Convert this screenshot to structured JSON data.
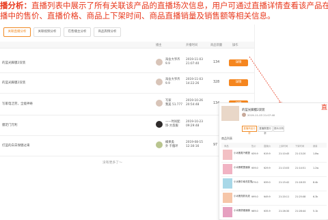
{
  "header": {
    "line1_prefix": "播分析：",
    "line1_body": "直播列表中展示了所有关联该产品的直播场次信息，用户可通过直播详情查看该产品在",
    "line2": "播中的售价、直播价格、商品上下架时间、商品直播销量及销售额等相关信息。"
  },
  "tabs": [
    "关联直播分析",
    "关联视频分析",
    "在售播主分析",
    "商品舆情分析"
  ],
  "table_headers": [
    "播主",
    "开播时间",
    "商品销量",
    "操作"
  ],
  "rows": [
    {
      "title": "的蓝光脚膜2双装",
      "anchor": "海舍大爷齐",
      "anchor_sub": "9.9",
      "date": "2019-11-03",
      "time": "21:07:40",
      "count": "134",
      "button": "详情"
    },
    {
      "title": "的蓝光脚膜2双装",
      "anchor": "海舍大爷齐",
      "anchor_sub": "9.9",
      "date": "2019-11-03",
      "time": "14:22:26",
      "count": "328",
      "button": "详情"
    },
    {
      "title": "写家电洁劳，全能神奇",
      "anchor": "写家",
      "anchor_sub": "我美 51.777",
      "date": "2019-10-26",
      "time": "20:54:48",
      "count": "134",
      "button": "详情"
    },
    {
      "title": "膜足门元利",
      "anchor": "——时尚配",
      "anchor_sub": "饰-大叔服",
      "date": "2019-10-23",
      "time": "09:29:48",
      "count": "",
      "button": ""
    },
    {
      "title": "打蓝的白羊保健过来",
      "anchor": "橘果类",
      "anchor_sub": "外 干循环",
      "date": "2019-08-15",
      "time": "12:30:16",
      "count": "97",
      "button": ""
    }
  ],
  "no_more": "没有更多了～",
  "popup": {
    "title": "的蓝光脚膜2双装",
    "meta": "2019-11-03 21:07:40",
    "tabs": [
      "直播商品分析",
      "直播数据分析",
      "观众分析"
    ],
    "section_title": "商品列表",
    "headers": [
      "商品",
      "售价",
      "直播价",
      "上架时间",
      "下架时间",
      "销量"
    ],
    "rows": [
      {
        "name": "小冰蛋蒸汽眼罩",
        "price": "¥39.9",
        "live": "¥19.9",
        "up": "21:10:45",
        "down": "21:13:20",
        "sales": "1.8w"
      },
      {
        "name": "小冰蛋眼罩面膜",
        "price": "¥59.0",
        "live": "¥29.9",
        "up": "21:13:03",
        "down": "21:14:51",
        "sales": "1.2w"
      },
      {
        "name": "小冰蛋中南洗发膏",
        "price": "¥79.0",
        "live": "¥39.0",
        "up": "21:15:42",
        "down": "21:18:33",
        "sales": "8.4k"
      },
      {
        "name": "小冰蛋亮肤乳液",
        "price": "¥99.0",
        "live": "¥49.9",
        "up": "21:20:11",
        "down": "21:25:08",
        "sales": "6.3k"
      },
      {
        "name": "小冰蛋舒缓面膜",
        "price": "¥69.0",
        "live": "¥35.9",
        "up": "21:26:30",
        "down": "21:28:44",
        "sales": "5.1k"
      }
    ]
  },
  "side_label": "直",
  "colors": {
    "accent": "#f5861f",
    "annotation": "#e8371b"
  }
}
